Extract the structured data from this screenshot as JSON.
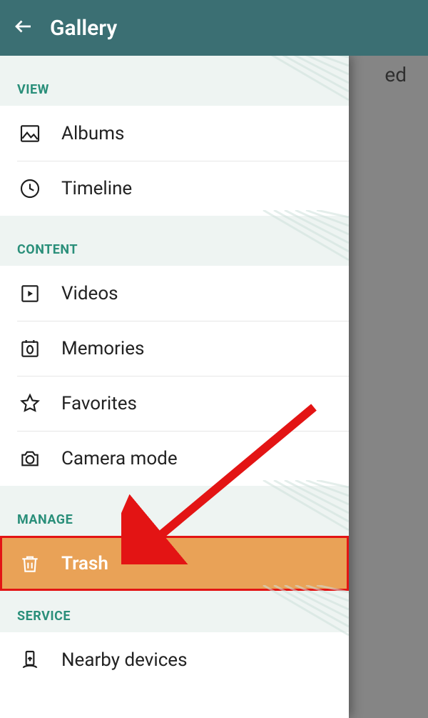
{
  "header": {
    "title": "Gallery"
  },
  "backdrop_text": "ed",
  "sections": {
    "view": {
      "label": "VIEW",
      "items": {
        "albums": "Albums",
        "timeline": "Timeline"
      }
    },
    "content": {
      "label": "CONTENT",
      "items": {
        "videos": "Videos",
        "memories": "Memories",
        "favorites": "Favorites",
        "camera_mode": "Camera mode"
      }
    },
    "manage": {
      "label": "MANAGE",
      "items": {
        "trash": "Trash"
      }
    },
    "service": {
      "label": "SERVICE",
      "items": {
        "nearby": "Nearby devices"
      }
    }
  },
  "annotation": {
    "highlight_color": "#e31414",
    "arrow_color": "#e31414"
  }
}
